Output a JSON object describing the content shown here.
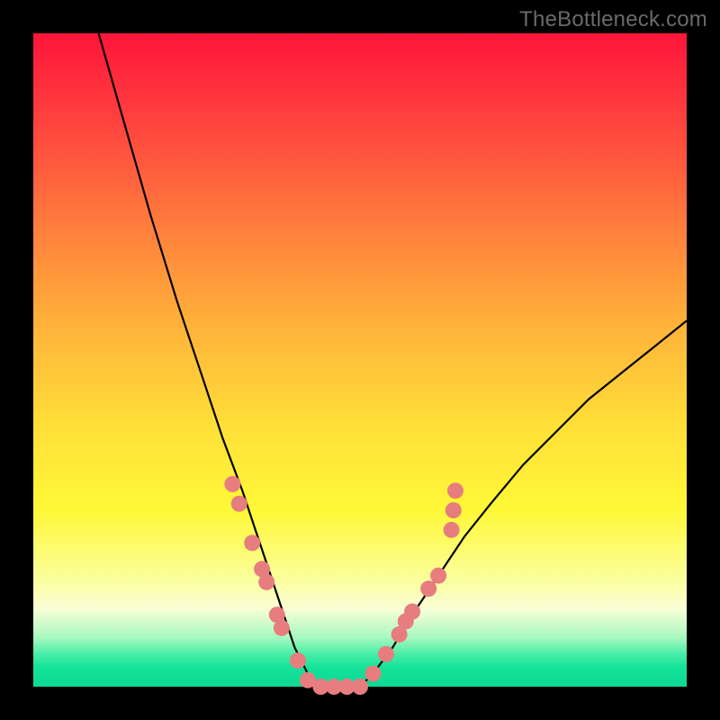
{
  "watermark": "TheBottleneck.com",
  "colors": {
    "frame": "#000000",
    "gradient_top": "#ff153a",
    "gradient_bottom": "#0cd893",
    "curve_stroke": "#000000",
    "marker_fill": "#e77d7f"
  },
  "chart_data": {
    "type": "line",
    "title": "",
    "xlabel": "",
    "ylabel": "",
    "xlim": [
      0,
      100
    ],
    "ylim": [
      0,
      100
    ],
    "grid": false,
    "legend": false,
    "notes": "V-shaped bottleneck curve over a vertical green-to-red gradient. Y is mismatch (%), higher = worse. Minimum plateau roughly between x≈41 and x≈50 at y≈0. Left branch starts near (10,100); right branch reaches ~(100,55). Salmon circular markers cluster on both branches near the bottom.",
    "series": [
      {
        "name": "bottleneck-curve",
        "x": [
          10,
          14,
          18,
          22,
          26,
          29,
          32,
          34,
          36,
          38,
          40,
          42,
          44,
          46,
          48,
          50,
          52,
          55,
          58,
          62,
          66,
          70,
          75,
          80,
          85,
          90,
          95,
          100
        ],
        "y": [
          100,
          86,
          72,
          59,
          47,
          38,
          30,
          24,
          18,
          12,
          6,
          2,
          0,
          0,
          0,
          0,
          2,
          6,
          11,
          17,
          23,
          28,
          34,
          39,
          44,
          48,
          52,
          56
        ]
      }
    ],
    "markers": [
      {
        "x": 30.5,
        "y": 31
      },
      {
        "x": 31.5,
        "y": 28
      },
      {
        "x": 33.5,
        "y": 22
      },
      {
        "x": 35.0,
        "y": 18
      },
      {
        "x": 35.7,
        "y": 16
      },
      {
        "x": 37.3,
        "y": 11
      },
      {
        "x": 38.0,
        "y": 9
      },
      {
        "x": 40.5,
        "y": 4
      },
      {
        "x": 42.0,
        "y": 1
      },
      {
        "x": 44.0,
        "y": 0
      },
      {
        "x": 46.0,
        "y": 0
      },
      {
        "x": 48.0,
        "y": 0
      },
      {
        "x": 50.0,
        "y": 0
      },
      {
        "x": 52.0,
        "y": 2
      },
      {
        "x": 54.0,
        "y": 5
      },
      {
        "x": 56.0,
        "y": 8
      },
      {
        "x": 57.0,
        "y": 10
      },
      {
        "x": 58.0,
        "y": 11.5
      },
      {
        "x": 60.5,
        "y": 15
      },
      {
        "x": 62.0,
        "y": 17
      },
      {
        "x": 64.0,
        "y": 24
      },
      {
        "x": 64.3,
        "y": 27
      },
      {
        "x": 64.6,
        "y": 30
      }
    ]
  }
}
